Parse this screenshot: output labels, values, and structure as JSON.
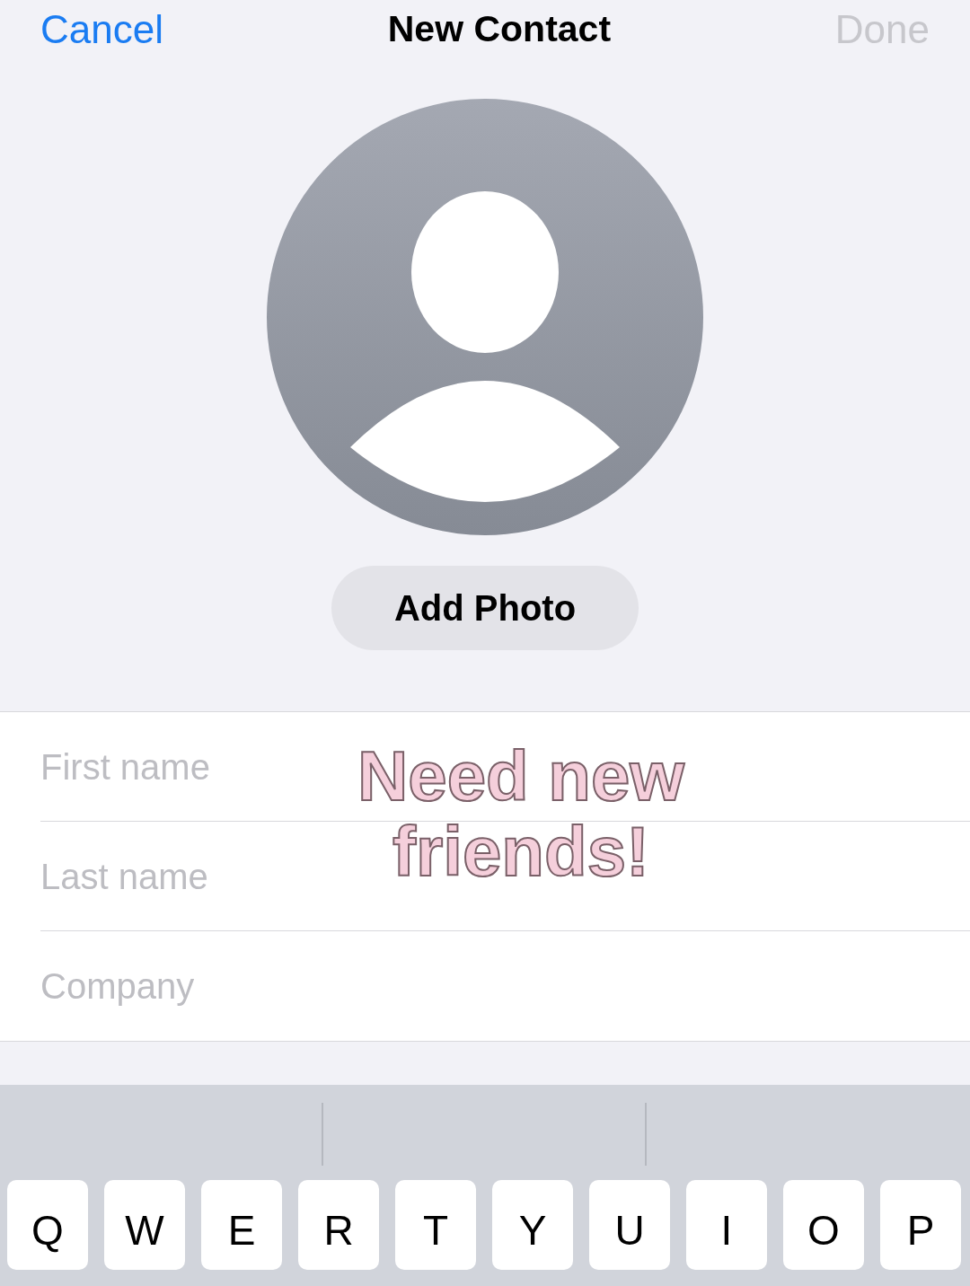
{
  "nav": {
    "cancel": "Cancel",
    "title": "New Contact",
    "done": {
      "label": "Done",
      "disabled": true
    }
  },
  "add_photo_button": "Add Photo",
  "fields": [
    {
      "placeholder": "First name"
    },
    {
      "placeholder": "Last name"
    },
    {
      "placeholder": "Company"
    }
  ],
  "overlay_text": "Need new friends!",
  "keyboard": {
    "keys": [
      "Q",
      "W",
      "E",
      "R",
      "T",
      "Y",
      "U",
      "I",
      "O",
      "P"
    ]
  }
}
